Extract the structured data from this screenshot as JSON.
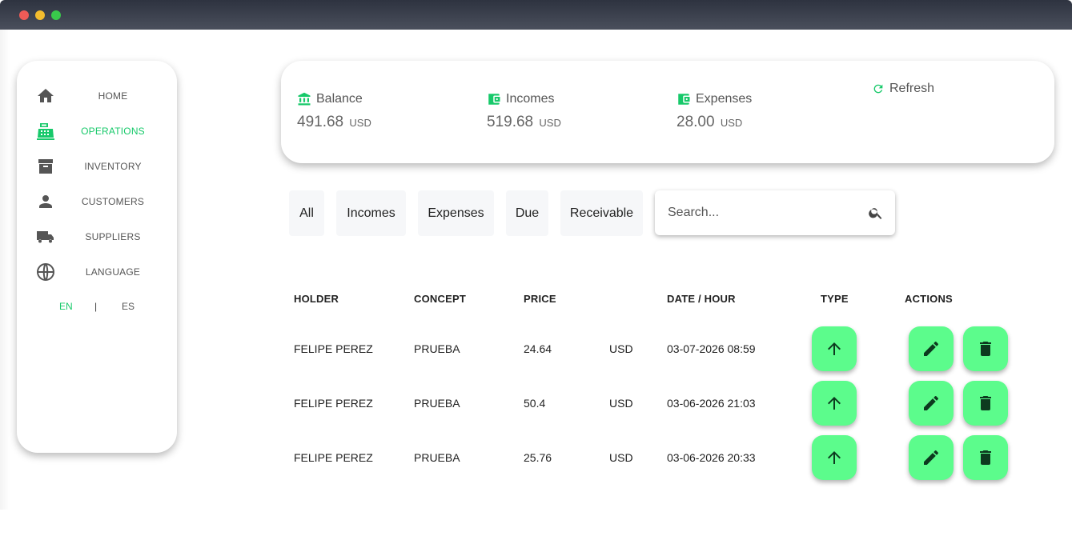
{
  "window": {
    "controls": [
      "close",
      "minimize",
      "maximize"
    ]
  },
  "sidebar": {
    "items": [
      {
        "label": "HOME",
        "icon": "home-icon"
      },
      {
        "label": "OPERATIONS",
        "icon": "cash-register-icon",
        "active": true
      },
      {
        "label": "INVENTORY",
        "icon": "archive-icon"
      },
      {
        "label": "CUSTOMERS",
        "icon": "person-icon"
      },
      {
        "label": "SUPPLIERS",
        "icon": "truck-icon"
      },
      {
        "label": "LANGUAGE",
        "icon": "globe-icon"
      }
    ],
    "languages": {
      "en": "EN",
      "separator": "|",
      "es": "ES",
      "active": "EN"
    }
  },
  "summary": {
    "balance": {
      "title": "Balance",
      "value": "491.68",
      "currency": "USD",
      "icon": "bank-icon"
    },
    "incomes": {
      "title": "Incomes",
      "value": "519.68",
      "currency": "USD",
      "icon": "wallet-icon"
    },
    "expenses": {
      "title": "Expenses",
      "value": "28.00",
      "currency": "USD",
      "icon": "wallet-icon"
    },
    "refresh_label": "Refresh"
  },
  "filters": [
    "All",
    "Incomes",
    "Expenses",
    "Due",
    "Receivable"
  ],
  "search": {
    "placeholder": "Search...",
    "value": ""
  },
  "table": {
    "headers": {
      "holder": "HOLDER",
      "concept": "CONCEPT",
      "price": "PRICE",
      "date": "DATE / HOUR",
      "type": "TYPE",
      "actions": "ACTIONS"
    },
    "rows": [
      {
        "holder": "FELIPE PEREZ",
        "concept": "PRUEBA",
        "price": "24.64",
        "currency": "USD",
        "date": "03-07-2026 08:59",
        "type": "arrow-up-icon"
      },
      {
        "holder": "FELIPE PEREZ",
        "concept": "PRUEBA",
        "price": "50.4",
        "currency": "USD",
        "date": "03-06-2026 21:03",
        "type": "arrow-up-icon"
      },
      {
        "holder": "FELIPE PEREZ",
        "concept": "PRUEBA",
        "price": "25.76",
        "currency": "USD",
        "date": "03-06-2026 20:33",
        "type": "arrow-up-icon"
      }
    ]
  },
  "colors": {
    "accent": "#17c96a",
    "button": "#5cfc8c",
    "icon": "#555555",
    "button_icon": "#0d3a1f"
  }
}
